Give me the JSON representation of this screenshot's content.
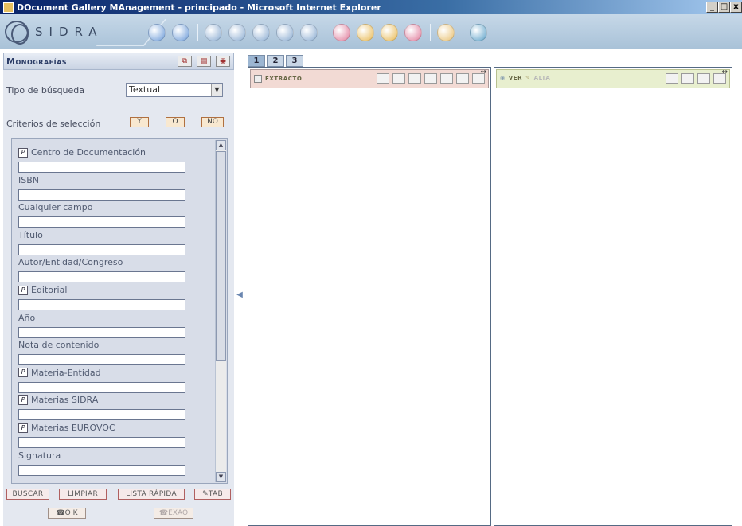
{
  "window": {
    "title": "DOcument Gallery MAnagement - principado - Microsoft Internet Explorer",
    "buttons": [
      "_",
      "□",
      "x"
    ]
  },
  "app": {
    "logo_text": "SIDRA"
  },
  "toolbar": {
    "icons": [
      {
        "name": "back-icon",
        "color": "#6a9ad8"
      },
      {
        "name": "forward-icon",
        "color": "#6a9ad8"
      },
      {
        "name": "search-icon",
        "color": "#88aad0"
      },
      {
        "name": "document-icon",
        "color": "#88aad0"
      },
      {
        "name": "tools-icon",
        "color": "#88aad0"
      },
      {
        "name": "list-icon",
        "color": "#88aad0"
      },
      {
        "name": "pin-icon",
        "color": "#88aad0"
      },
      {
        "name": "mail-icon",
        "color": "#e07a9a"
      },
      {
        "name": "notes-icon",
        "color": "#e8b850"
      },
      {
        "name": "help-icon",
        "color": "#e8b850"
      },
      {
        "name": "close-icon",
        "color": "#e07a9a"
      },
      {
        "name": "hand-icon",
        "color": "#e8c070"
      },
      {
        "name": "book-icon",
        "color": "#5aa0c8"
      }
    ]
  },
  "left_panel": {
    "title": "Monografías",
    "search_type_label": "Tipo de búsqueda",
    "search_type_value": "Textual",
    "criteria_label": "Criterios de selección",
    "criteria_buttons": [
      "Y",
      "O",
      "NO"
    ],
    "fields": [
      {
        "label": "Centro de Documentación",
        "has_icon": true
      },
      {
        "label": "ISBN",
        "has_icon": false
      },
      {
        "label": "Cualquier campo",
        "has_icon": false
      },
      {
        "label": "Título",
        "has_icon": false
      },
      {
        "label": "Autor/Entidad/Congreso",
        "has_icon": false
      },
      {
        "label": "Editorial",
        "has_icon": true
      },
      {
        "label": "Año",
        "has_icon": false
      },
      {
        "label": "Nota de contenido",
        "has_icon": false
      },
      {
        "label": "Materia-Entidad",
        "has_icon": true
      },
      {
        "label": "Materias SIDRA",
        "has_icon": true
      },
      {
        "label": "Materias EUROVOC",
        "has_icon": true
      },
      {
        "label": "Signatura",
        "has_icon": false
      }
    ],
    "action_buttons": [
      "BUSCAR",
      "LIMPIAR",
      "LISTA RÁPIDA",
      "TAB"
    ],
    "ok_label": "O K",
    "clear_label": "EXAO"
  },
  "tabs": [
    "1",
    "2",
    "3"
  ],
  "extract_pane": {
    "title": "EXTRACTO"
  },
  "view_pane": {
    "title_ver": "VER",
    "title_alta": "ALTA"
  }
}
